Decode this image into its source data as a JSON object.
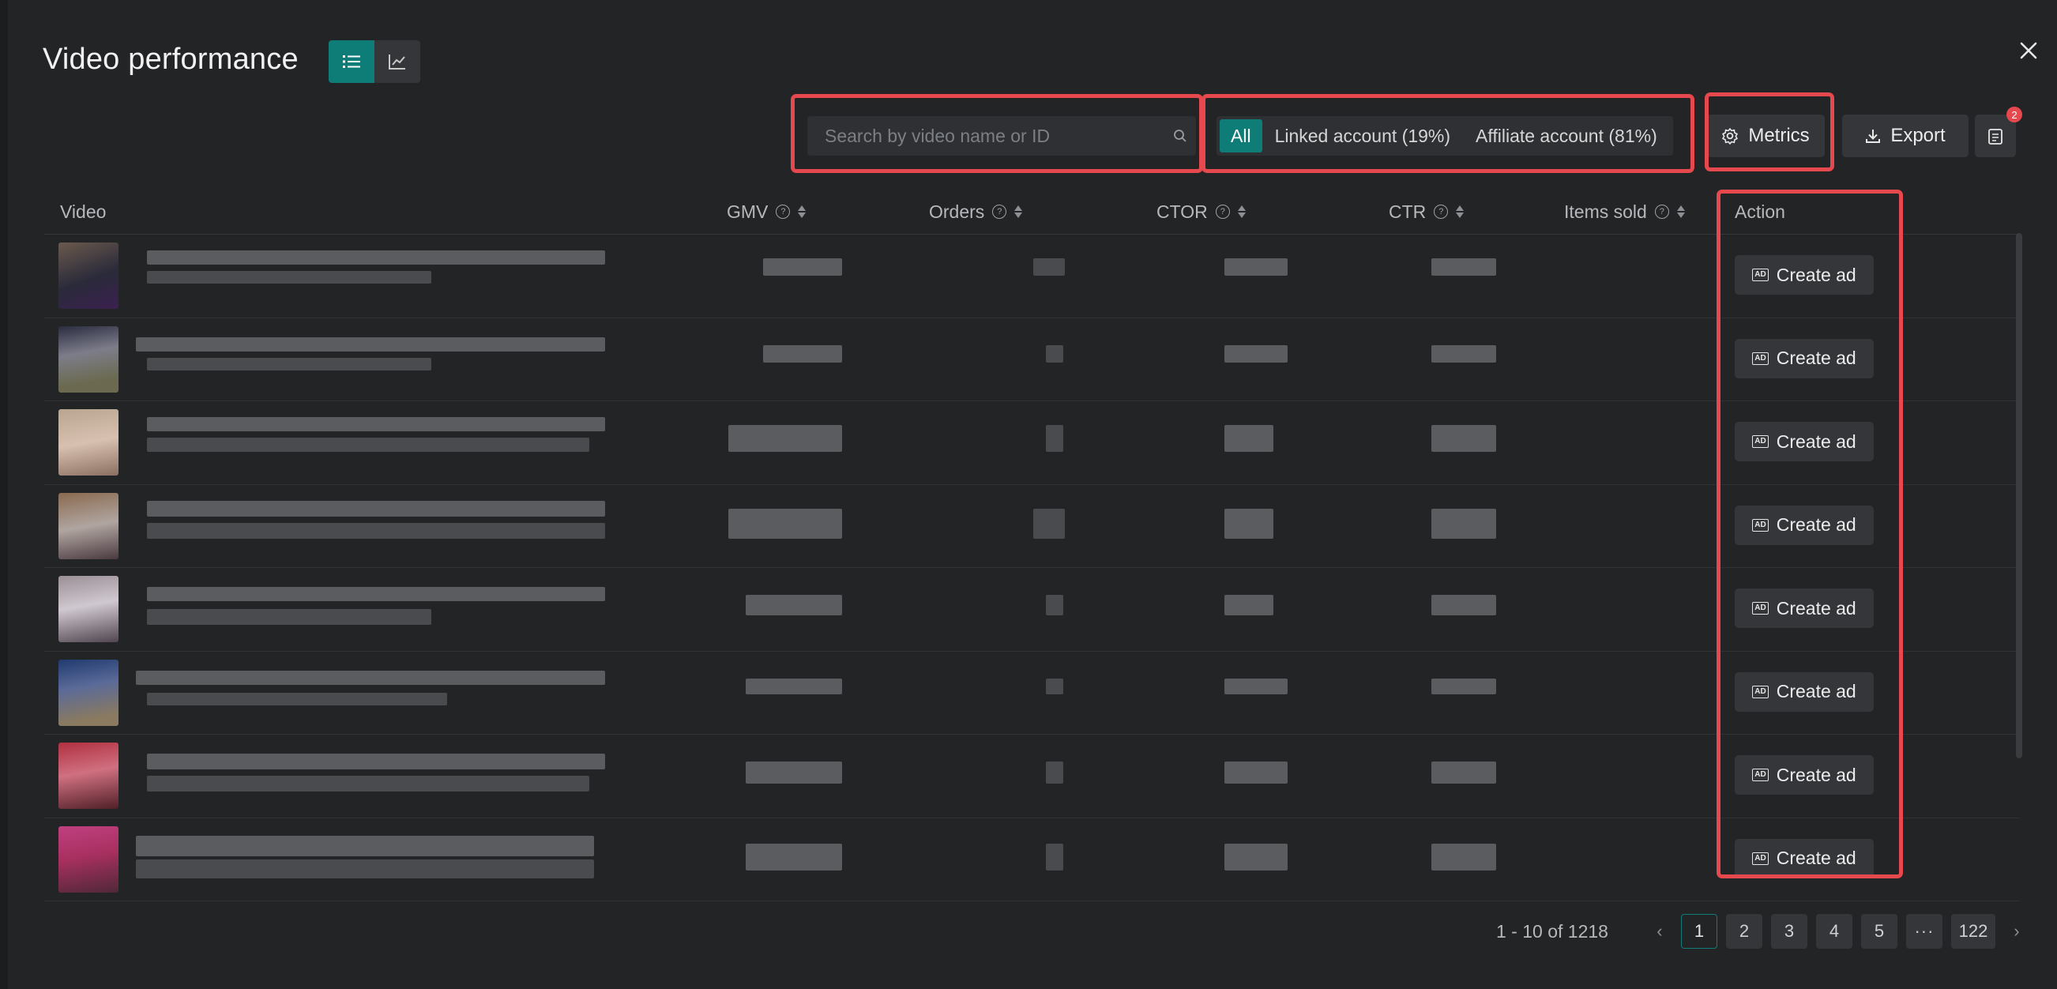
{
  "modal": {
    "title": "Video performance",
    "view_toggle": {
      "list_icon": "list-icon",
      "chart_icon": "line-chart-icon",
      "active": "list"
    },
    "close_icon": "close-icon"
  },
  "toolbar": {
    "search_placeholder": "Search by video name or ID",
    "filters": [
      "All",
      "Linked account (19%)",
      "Affiliate account (81%)"
    ],
    "active_filter": "All",
    "metrics_label": "Metrics",
    "export_label": "Export",
    "notes_badge": "2"
  },
  "table": {
    "columns": {
      "video": "Video",
      "gmv": "GMV",
      "orders": "Orders",
      "ctor": "CTOR",
      "ctr": "CTR",
      "items_sold": "Items sold",
      "action": "Action"
    },
    "action_label": "Create ad",
    "action_icon": "ad-icon",
    "row_count_visible": 8
  },
  "pagination": {
    "range": "1 - 10 of 1218",
    "pages": [
      "1",
      "2",
      "3",
      "4",
      "5",
      "···",
      "122"
    ],
    "current": "1"
  },
  "colors": {
    "accent": "#0e7c77",
    "highlight": "#e5484d",
    "background": "#232426",
    "badge": "#e5484d"
  }
}
